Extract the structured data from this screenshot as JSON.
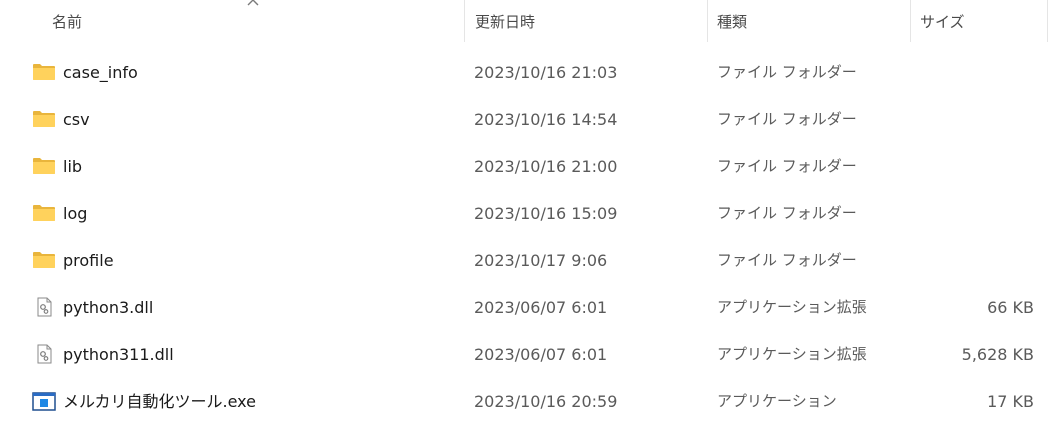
{
  "columns": {
    "name": "名前",
    "date": "更新日時",
    "type": "種類",
    "size": "サイズ"
  },
  "sort": {
    "column": "name",
    "direction": "ascending",
    "icon": "chevron-up-icon"
  },
  "files": [
    {
      "name": "case_info",
      "date": "2023/10/16 21:03",
      "type": "ファイル フォルダー",
      "size": "",
      "icon": "folder-icon"
    },
    {
      "name": "csv",
      "date": "2023/10/16 14:54",
      "type": "ファイル フォルダー",
      "size": "",
      "icon": "folder-icon"
    },
    {
      "name": "lib",
      "date": "2023/10/16 21:00",
      "type": "ファイル フォルダー",
      "size": "",
      "icon": "folder-icon"
    },
    {
      "name": "log",
      "date": "2023/10/16 15:09",
      "type": "ファイル フォルダー",
      "size": "",
      "icon": "folder-icon"
    },
    {
      "name": "profile",
      "date": "2023/10/17 9:06",
      "type": "ファイル フォルダー",
      "size": "",
      "icon": "folder-icon"
    },
    {
      "name": "python3.dll",
      "date": "2023/06/07 6:01",
      "type": "アプリケーション拡張",
      "size": "66 KB",
      "icon": "dll-file-icon"
    },
    {
      "name": "python311.dll",
      "date": "2023/06/07 6:01",
      "type": "アプリケーション拡張",
      "size": "5,628 KB",
      "icon": "dll-file-icon"
    },
    {
      "name": "メルカリ自動化ツール.exe",
      "date": "2023/10/16 20:59",
      "type": "アプリケーション",
      "size": "17 KB",
      "icon": "exe-application-icon"
    }
  ]
}
